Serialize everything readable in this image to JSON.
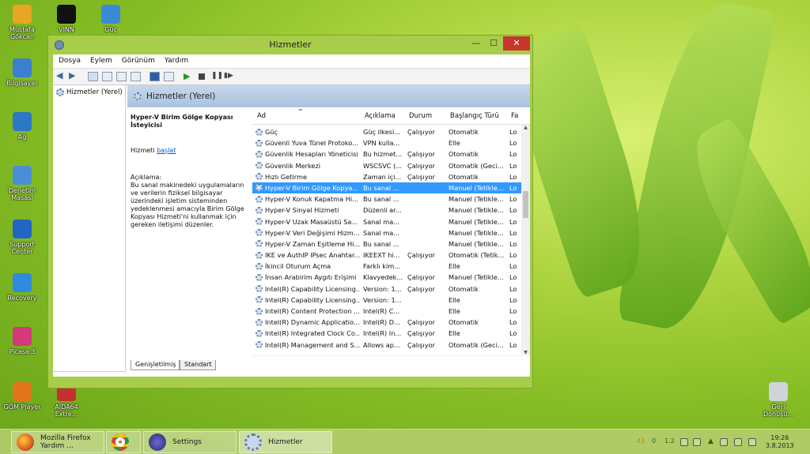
{
  "desktop_icons": [
    {
      "label": "Mustafa Gökcan",
      "icon": "user-folder-icon",
      "color": "#e8a623"
    },
    {
      "label": "VINN",
      "icon": "vinn-app-icon",
      "color": "#111111"
    },
    {
      "label": "Güç",
      "icon": "power-icon",
      "color": "#3a8ad6"
    },
    {
      "label": "Bilgisayar",
      "icon": "computer-icon",
      "color": "#3a7fd0"
    },
    {
      "label": "Ağ",
      "icon": "network-icon",
      "color": "#2d77c7"
    },
    {
      "label": "Denetim Masası",
      "icon": "control-panel-icon",
      "color": "#4a8ed8"
    },
    {
      "label": "Support Center",
      "icon": "support-center-icon",
      "color": "#2166c2"
    },
    {
      "label": "Recovery",
      "icon": "recovery-icon",
      "color": "#2f8be0"
    },
    {
      "label": "Picasa 3",
      "icon": "picasa-icon",
      "color": "#d23a7a"
    },
    {
      "label": "GOM Player",
      "icon": "gom-player-icon",
      "color": "#e3761c"
    },
    {
      "label": "AIDA64 Extre...",
      "icon": "aida64-icon",
      "color": "#c53030"
    },
    {
      "label": "Geri Dönüşü...",
      "icon": "recycle-bin-icon",
      "color": "#d0d4d8"
    }
  ],
  "window": {
    "title": "Hizmetler",
    "minimize": "—",
    "maximize": "☐",
    "close": "✕"
  },
  "menu": [
    "Dosya",
    "Eylem",
    "Görünüm",
    "Yardım"
  ],
  "tree": {
    "root": "Hizmetler (Yerel)"
  },
  "panel": {
    "header": "Hizmetler (Yerel)",
    "selected_title": "Hyper-V Birim Gölge Kopyası İsteyicisi",
    "action_prefix": "Hizmeti",
    "action_link": "başlat",
    "desc_label": "Açıklama:",
    "desc_text": "Bu sanal makinedeki uygulamaların ve verilerin fiziksel bilgisayar üzerindeki işletim sisteminden yedeklenmesi amacıyla Birim Gölge Kopyası Hizmeti'ni kullanmak için gereken iletişimi düzenler."
  },
  "columns": [
    "Ad",
    "Açıklama",
    "Durum",
    "Başlangıç Türü",
    "Fa"
  ],
  "services": [
    [
      "Güç",
      "Güç ilkesi...",
      "Çalışıyor",
      "Otomatik",
      "Lo"
    ],
    [
      "Güvenli Yuva Tünel Protoko...",
      "VPN kulla...",
      "",
      "Elle",
      "Lo"
    ],
    [
      "Güvenlik Hesapları Yöneticisi",
      "Bu hizmet...",
      "Çalışıyor",
      "Otomatik",
      "Lo"
    ],
    [
      "Güvenlik Merkezi",
      "WSCSVC (...",
      "Çalışıyor",
      "Otomatik (Geci...",
      "Lo"
    ],
    [
      "Hızlı Getirme",
      "Zaman içi...",
      "Çalışıyor",
      "Otomatik",
      "Lo"
    ],
    [
      "Hyper-V Birim Gölge Kopya...",
      "Bu sanal ...",
      "",
      "Manuel (Tetikle...",
      "Lo"
    ],
    [
      "Hyper-V Konuk Kapatma Hi...",
      "Bu sanal ...",
      "",
      "Manuel (Tetikle...",
      "Lo"
    ],
    [
      "Hyper-V Sinyal Hizmeti",
      "Düzenli ar...",
      "",
      "Manuel (Tetikle...",
      "Lo"
    ],
    [
      "Hyper-V Uzak Masaüstü Sa...",
      "Sanal ma...",
      "",
      "Manuel (Tetikle...",
      "Lo"
    ],
    [
      "Hyper-V Veri Değişimi Hizm...",
      "Sanal ma...",
      "",
      "Manuel (Tetikle...",
      "Lo"
    ],
    [
      "Hyper-V Zaman Eşitleme Hi...",
      "Bu sanal ...",
      "",
      "Manuel (Tetikle...",
      "Lo"
    ],
    [
      "IKE ve AuthIP IPsec Anahtar...",
      "IKEEXT hi...",
      "Çalışıyor",
      "Otomatik (Tetik...",
      "Lo"
    ],
    [
      "İkincil Oturum Açma",
      "Farklı kim...",
      "",
      "Elle",
      "Lo"
    ],
    [
      "İnsan Arabirim Aygıtı Erişimi",
      "Klavyedek...",
      "Çalışıyor",
      "Manuel (Tetikle...",
      "Lo"
    ],
    [
      "Intel(R) Capability Licensing...",
      "Version: 1...",
      "Çalışıyor",
      "Otomatik",
      "Lo"
    ],
    [
      "Intel(R) Capability Licensing...",
      "Version: 1...",
      "",
      "Elle",
      "Lo"
    ],
    [
      "Intel(R) Content Protection ...",
      "Intel(R) C...",
      "",
      "Elle",
      "Lo"
    ],
    [
      "Intel(R) Dynamic Applicatio...",
      "Intel(R) D...",
      "Çalışıyor",
      "Otomatik",
      "Lo"
    ],
    [
      "Intel(R) Integrated Clock Co...",
      "Intel(R) In...",
      "Çalışıyor",
      "Elle",
      "Lo"
    ],
    [
      "Intel(R) Management and S...",
      "Allows ap...",
      "Çalışıyor",
      "Otomatik (Geci...",
      "Lo"
    ]
  ],
  "selected_index": 5,
  "tabs": [
    "Genişletilmiş",
    "Standart"
  ],
  "taskbar": {
    "items": [
      {
        "label": "Mozilla Firefox Yardım ...",
        "icon": "firefox-icon"
      },
      {
        "label": "",
        "icon": "chrome-icon"
      },
      {
        "label": "Settings",
        "icon": "settings-icon"
      },
      {
        "label": "Hizmetler",
        "icon": "services-icon"
      }
    ],
    "tray_values": [
      "43",
      "0",
      "1.2"
    ],
    "time": "19:26",
    "date": "3.8.2013"
  }
}
